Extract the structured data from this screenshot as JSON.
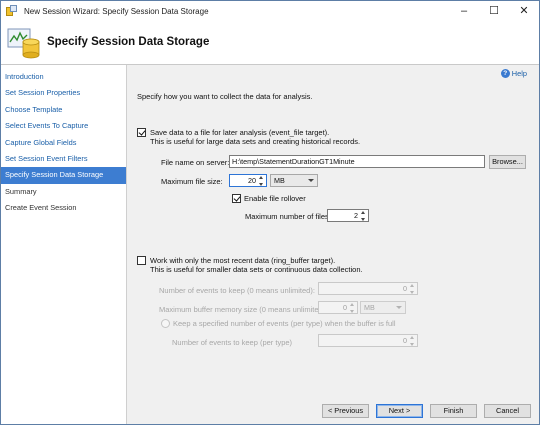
{
  "window": {
    "title": "New Session Wizard: Specify Session Data Storage"
  },
  "header": {
    "title": "Specify Session Data Storage"
  },
  "sidebar": {
    "items": [
      {
        "label": "Introduction"
      },
      {
        "label": "Set Session Properties"
      },
      {
        "label": "Choose Template"
      },
      {
        "label": "Select Events To Capture"
      },
      {
        "label": "Capture Global Fields"
      },
      {
        "label": "Set Session Event Filters"
      },
      {
        "label": "Specify Session Data Storage"
      },
      {
        "label": "Summary"
      },
      {
        "label": "Create Event Session"
      }
    ]
  },
  "help": {
    "label": "Help"
  },
  "main": {
    "intro": "Specify how you want to collect the data for analysis.",
    "file_target": {
      "checkbox_label": "Save data to a file for later analysis (event_file target).",
      "description": "This is useful for large data sets and creating historical records.",
      "file_name_label": "File name on server:",
      "file_name_value": "H:\\temp\\StatementDurationGT1Minute",
      "browse_label": "Browse...",
      "max_size_label": "Maximum file size:",
      "max_size_value": "20",
      "max_size_unit": "MB",
      "rollover_label": "Enable file rollover",
      "max_files_label": "Maximum number of files:",
      "max_files_value": "2"
    },
    "ring_target": {
      "checkbox_label": "Work with only the most recent data (ring_buffer target).",
      "description": "This is useful for smaller data sets or continuous data collection.",
      "events_keep_label": "Number of events to keep (0 means unlimited):",
      "events_keep_value": "0",
      "buffer_label": "Maximum buffer memory size (0 means unlimited):",
      "buffer_value": "0",
      "buffer_unit": "MB",
      "per_type_label": "Keep a specified number of events (per type) when the buffer is full",
      "per_type_count_label": "Number of events to keep (per type)",
      "per_type_count_value": "0"
    }
  },
  "footer": {
    "previous_label": "< Previous",
    "next_label": "Next >",
    "finish_label": "Finish",
    "cancel_label": "Cancel"
  }
}
